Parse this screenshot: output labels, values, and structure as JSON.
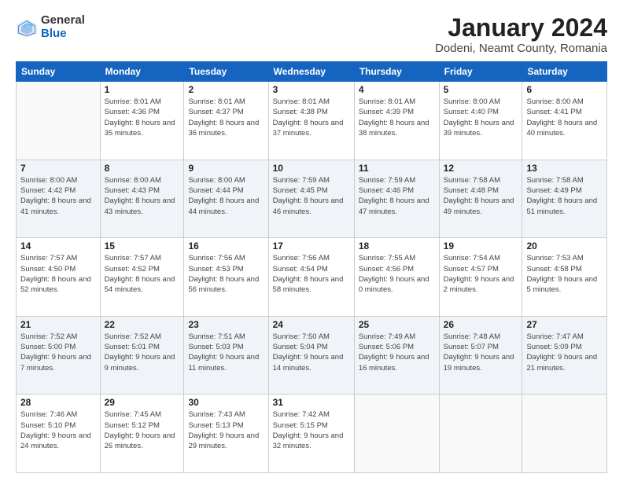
{
  "logo": {
    "general": "General",
    "blue": "Blue"
  },
  "title": "January 2024",
  "subtitle": "Dodeni, Neamt County, Romania",
  "headers": [
    "Sunday",
    "Monday",
    "Tuesday",
    "Wednesday",
    "Thursday",
    "Friday",
    "Saturday"
  ],
  "weeks": [
    [
      {
        "day": "",
        "sunrise": "",
        "sunset": "",
        "daylight": ""
      },
      {
        "day": "1",
        "sunrise": "Sunrise: 8:01 AM",
        "sunset": "Sunset: 4:36 PM",
        "daylight": "Daylight: 8 hours and 35 minutes."
      },
      {
        "day": "2",
        "sunrise": "Sunrise: 8:01 AM",
        "sunset": "Sunset: 4:37 PM",
        "daylight": "Daylight: 8 hours and 36 minutes."
      },
      {
        "day": "3",
        "sunrise": "Sunrise: 8:01 AM",
        "sunset": "Sunset: 4:38 PM",
        "daylight": "Daylight: 8 hours and 37 minutes."
      },
      {
        "day": "4",
        "sunrise": "Sunrise: 8:01 AM",
        "sunset": "Sunset: 4:39 PM",
        "daylight": "Daylight: 8 hours and 38 minutes."
      },
      {
        "day": "5",
        "sunrise": "Sunrise: 8:00 AM",
        "sunset": "Sunset: 4:40 PM",
        "daylight": "Daylight: 8 hours and 39 minutes."
      },
      {
        "day": "6",
        "sunrise": "Sunrise: 8:00 AM",
        "sunset": "Sunset: 4:41 PM",
        "daylight": "Daylight: 8 hours and 40 minutes."
      }
    ],
    [
      {
        "day": "7",
        "sunrise": "Sunrise: 8:00 AM",
        "sunset": "Sunset: 4:42 PM",
        "daylight": "Daylight: 8 hours and 41 minutes."
      },
      {
        "day": "8",
        "sunrise": "Sunrise: 8:00 AM",
        "sunset": "Sunset: 4:43 PM",
        "daylight": "Daylight: 8 hours and 43 minutes."
      },
      {
        "day": "9",
        "sunrise": "Sunrise: 8:00 AM",
        "sunset": "Sunset: 4:44 PM",
        "daylight": "Daylight: 8 hours and 44 minutes."
      },
      {
        "day": "10",
        "sunrise": "Sunrise: 7:59 AM",
        "sunset": "Sunset: 4:45 PM",
        "daylight": "Daylight: 8 hours and 46 minutes."
      },
      {
        "day": "11",
        "sunrise": "Sunrise: 7:59 AM",
        "sunset": "Sunset: 4:46 PM",
        "daylight": "Daylight: 8 hours and 47 minutes."
      },
      {
        "day": "12",
        "sunrise": "Sunrise: 7:58 AM",
        "sunset": "Sunset: 4:48 PM",
        "daylight": "Daylight: 8 hours and 49 minutes."
      },
      {
        "day": "13",
        "sunrise": "Sunrise: 7:58 AM",
        "sunset": "Sunset: 4:49 PM",
        "daylight": "Daylight: 8 hours and 51 minutes."
      }
    ],
    [
      {
        "day": "14",
        "sunrise": "Sunrise: 7:57 AM",
        "sunset": "Sunset: 4:50 PM",
        "daylight": "Daylight: 8 hours and 52 minutes."
      },
      {
        "day": "15",
        "sunrise": "Sunrise: 7:57 AM",
        "sunset": "Sunset: 4:52 PM",
        "daylight": "Daylight: 8 hours and 54 minutes."
      },
      {
        "day": "16",
        "sunrise": "Sunrise: 7:56 AM",
        "sunset": "Sunset: 4:53 PM",
        "daylight": "Daylight: 8 hours and 56 minutes."
      },
      {
        "day": "17",
        "sunrise": "Sunrise: 7:56 AM",
        "sunset": "Sunset: 4:54 PM",
        "daylight": "Daylight: 8 hours and 58 minutes."
      },
      {
        "day": "18",
        "sunrise": "Sunrise: 7:55 AM",
        "sunset": "Sunset: 4:56 PM",
        "daylight": "Daylight: 9 hours and 0 minutes."
      },
      {
        "day": "19",
        "sunrise": "Sunrise: 7:54 AM",
        "sunset": "Sunset: 4:57 PM",
        "daylight": "Daylight: 9 hours and 2 minutes."
      },
      {
        "day": "20",
        "sunrise": "Sunrise: 7:53 AM",
        "sunset": "Sunset: 4:58 PM",
        "daylight": "Daylight: 9 hours and 5 minutes."
      }
    ],
    [
      {
        "day": "21",
        "sunrise": "Sunrise: 7:52 AM",
        "sunset": "Sunset: 5:00 PM",
        "daylight": "Daylight: 9 hours and 7 minutes."
      },
      {
        "day": "22",
        "sunrise": "Sunrise: 7:52 AM",
        "sunset": "Sunset: 5:01 PM",
        "daylight": "Daylight: 9 hours and 9 minutes."
      },
      {
        "day": "23",
        "sunrise": "Sunrise: 7:51 AM",
        "sunset": "Sunset: 5:03 PM",
        "daylight": "Daylight: 9 hours and 11 minutes."
      },
      {
        "day": "24",
        "sunrise": "Sunrise: 7:50 AM",
        "sunset": "Sunset: 5:04 PM",
        "daylight": "Daylight: 9 hours and 14 minutes."
      },
      {
        "day": "25",
        "sunrise": "Sunrise: 7:49 AM",
        "sunset": "Sunset: 5:06 PM",
        "daylight": "Daylight: 9 hours and 16 minutes."
      },
      {
        "day": "26",
        "sunrise": "Sunrise: 7:48 AM",
        "sunset": "Sunset: 5:07 PM",
        "daylight": "Daylight: 9 hours and 19 minutes."
      },
      {
        "day": "27",
        "sunrise": "Sunrise: 7:47 AM",
        "sunset": "Sunset: 5:09 PM",
        "daylight": "Daylight: 9 hours and 21 minutes."
      }
    ],
    [
      {
        "day": "28",
        "sunrise": "Sunrise: 7:46 AM",
        "sunset": "Sunset: 5:10 PM",
        "daylight": "Daylight: 9 hours and 24 minutes."
      },
      {
        "day": "29",
        "sunrise": "Sunrise: 7:45 AM",
        "sunset": "Sunset: 5:12 PM",
        "daylight": "Daylight: 9 hours and 26 minutes."
      },
      {
        "day": "30",
        "sunrise": "Sunrise: 7:43 AM",
        "sunset": "Sunset: 5:13 PM",
        "daylight": "Daylight: 9 hours and 29 minutes."
      },
      {
        "day": "31",
        "sunrise": "Sunrise: 7:42 AM",
        "sunset": "Sunset: 5:15 PM",
        "daylight": "Daylight: 9 hours and 32 minutes."
      },
      {
        "day": "",
        "sunrise": "",
        "sunset": "",
        "daylight": ""
      },
      {
        "day": "",
        "sunrise": "",
        "sunset": "",
        "daylight": ""
      },
      {
        "day": "",
        "sunrise": "",
        "sunset": "",
        "daylight": ""
      }
    ]
  ]
}
